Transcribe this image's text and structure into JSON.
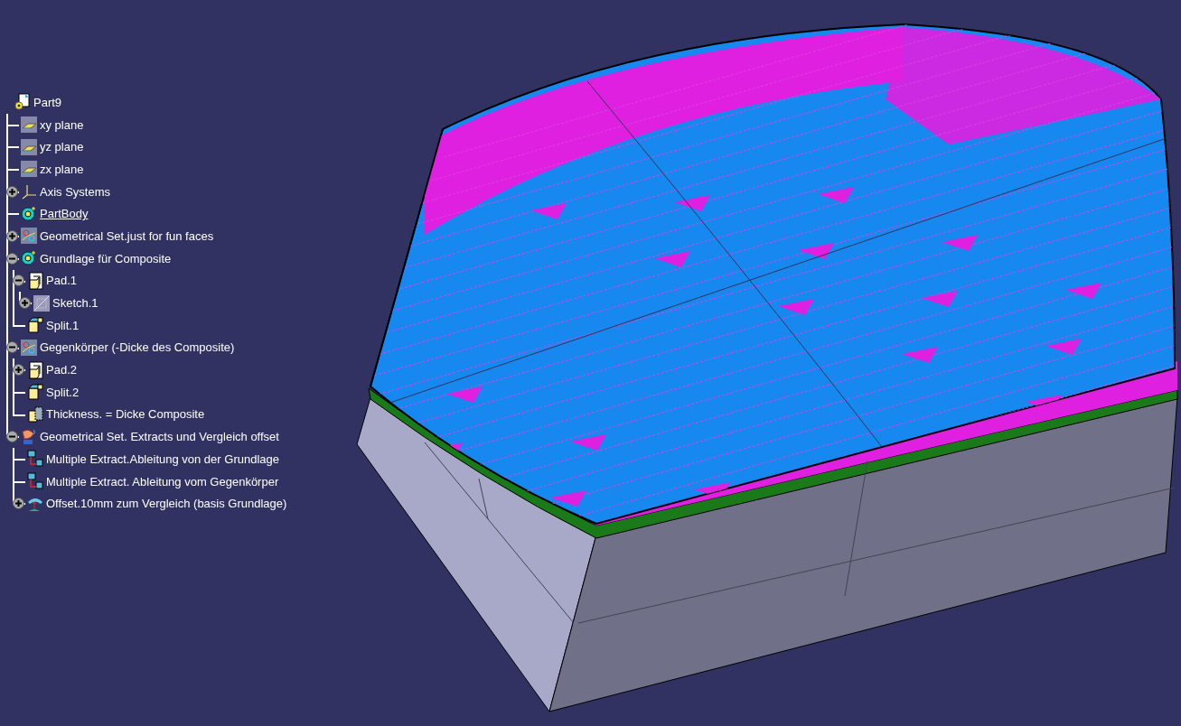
{
  "tree": {
    "label": "Part9",
    "kind": "part",
    "underlined": false,
    "children": [
      {
        "label": "xy plane",
        "kind": "plane",
        "underlined": false
      },
      {
        "label": "yz plane",
        "kind": "plane",
        "underlined": false
      },
      {
        "label": "zx plane",
        "kind": "plane",
        "underlined": false
      },
      {
        "label": "Axis Systems",
        "kind": "axis",
        "expanded": false,
        "underlined": false
      },
      {
        "label": "PartBody",
        "kind": "body",
        "underlined": true
      },
      {
        "label": "Geometrical Set.just for fun faces",
        "kind": "geoset",
        "expanded": false,
        "underlined": false
      },
      {
        "label": "Grundlage für Composite",
        "kind": "body",
        "expanded": true,
        "underlined": false,
        "children": [
          {
            "label": "Pad.1",
            "kind": "pad",
            "expanded": true,
            "underlined": false,
            "children": [
              {
                "label": "Sketch.1",
                "kind": "sketch",
                "expanded": false,
                "underlined": false
              }
            ]
          },
          {
            "label": "Split.1",
            "kind": "split",
            "underlined": false
          }
        ]
      },
      {
        "label": "Gegenkörper (-Dicke des Composite)",
        "kind": "geoset",
        "expanded": true,
        "underlined": false,
        "children": [
          {
            "label": "Pad.2",
            "kind": "pad",
            "expanded": false,
            "underlined": false
          },
          {
            "label": "Split.2",
            "kind": "split",
            "underlined": false
          },
          {
            "label": "Thickness. = Dicke Composite",
            "kind": "thickness",
            "underlined": false
          }
        ]
      },
      {
        "label": "Geometrical Set. Extracts und Vergleich offset",
        "kind": "geoset2",
        "expanded": true,
        "underlined": false,
        "children": [
          {
            "label": "Multiple Extract.Ableitung von der Grundlage",
            "kind": "extract",
            "underlined": false
          },
          {
            "label": "Multiple Extract. Ableitung vom Gegenkörper",
            "kind": "extract",
            "underlined": false
          },
          {
            "label": "Offset.10mm zum Vergleich (basis Grundlage)",
            "kind": "offset",
            "expanded": false,
            "underlined": false
          }
        ]
      }
    ]
  }
}
